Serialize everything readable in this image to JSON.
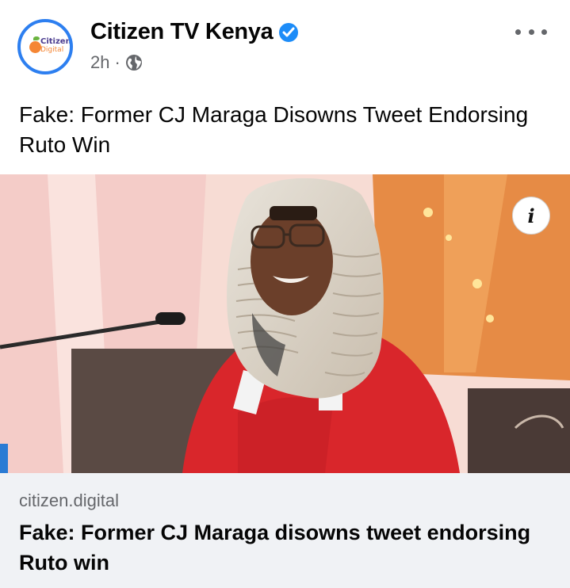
{
  "post": {
    "page_name": "Citizen TV Kenya",
    "time": "2h",
    "separator": "·",
    "verified": true,
    "privacy_icon": "globe-icon",
    "more_icon": "ellipsis-icon",
    "text": "Fake: Former CJ Maraga Disowns Tweet Endorsing Ruto Win"
  },
  "avatar": {
    "logo_line1": "Citizen",
    "logo_line2": "Digital"
  },
  "photo": {
    "info_label": "i"
  },
  "link": {
    "domain": "citizen.digital",
    "title": "Fake: Former CJ Maraga disowns tweet endorsing Ruto win"
  },
  "colors": {
    "verified_blue": "#1d8cf8",
    "avatar_ring": "#2d7ff0",
    "meta_gray": "#65676b",
    "preview_bg": "#f0f2f5",
    "robe_red": "#d9262b"
  }
}
